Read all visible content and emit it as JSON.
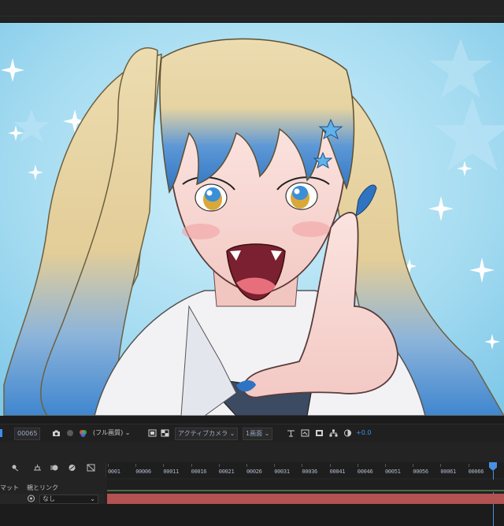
{
  "viewer": {
    "image_name": "anime-girl-frame"
  },
  "toolbar": {
    "timecode": "00065",
    "resolution": "(フル画質)",
    "camera": "アクティブカメラ",
    "views": "1画面",
    "exposure": "+0.0"
  },
  "timeline": {
    "ruler_ticks": [
      "0001",
      "00006",
      "00011",
      "00016",
      "00021",
      "00026",
      "00031",
      "00036",
      "00041",
      "00046",
      "00051",
      "00056",
      "00061",
      "00066"
    ],
    "header_mat": "マット",
    "header_parent": "親とリンク",
    "layer_parent_value": "なし"
  },
  "colors": {
    "accent": "#3d8ef0",
    "track": "#b25252",
    "sky": "#9dd6ee",
    "hair_blonde": "#e8d5a3",
    "hair_blue": "#3f86cf"
  }
}
